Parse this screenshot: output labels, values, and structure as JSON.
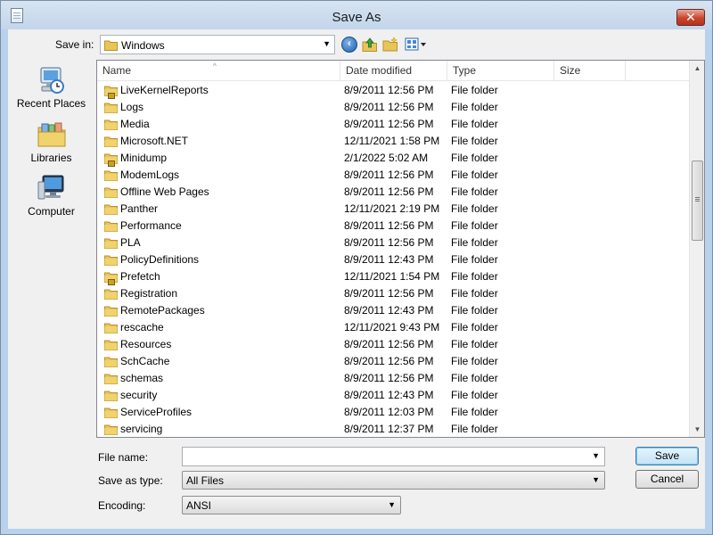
{
  "window": {
    "title": "Save As"
  },
  "toolbar": {
    "save_in_label": "Save in:",
    "save_in_value": "Windows"
  },
  "places": [
    {
      "label": "Recent Places",
      "icon": "recent-places-icon"
    },
    {
      "label": "Libraries",
      "icon": "libraries-icon"
    },
    {
      "label": "Computer",
      "icon": "computer-icon"
    }
  ],
  "columns": {
    "name": "Name",
    "date": "Date modified",
    "type": "Type",
    "size": "Size"
  },
  "files": [
    {
      "name": "LiveKernelReports",
      "date": "8/9/2011 12:56 PM",
      "type": "File folder",
      "locked": true
    },
    {
      "name": "Logs",
      "date": "8/9/2011 12:56 PM",
      "type": "File folder",
      "locked": false
    },
    {
      "name": "Media",
      "date": "8/9/2011 12:56 PM",
      "type": "File folder",
      "locked": false
    },
    {
      "name": "Microsoft.NET",
      "date": "12/11/2021 1:58 PM",
      "type": "File folder",
      "locked": false
    },
    {
      "name": "Minidump",
      "date": "2/1/2022 5:02 AM",
      "type": "File folder",
      "locked": true
    },
    {
      "name": "ModemLogs",
      "date": "8/9/2011 12:56 PM",
      "type": "File folder",
      "locked": false
    },
    {
      "name": "Offline Web Pages",
      "date": "8/9/2011 12:56 PM",
      "type": "File folder",
      "locked": false
    },
    {
      "name": "Panther",
      "date": "12/11/2021 2:19 PM",
      "type": "File folder",
      "locked": false
    },
    {
      "name": "Performance",
      "date": "8/9/2011 12:56 PM",
      "type": "File folder",
      "locked": false
    },
    {
      "name": "PLA",
      "date": "8/9/2011 12:56 PM",
      "type": "File folder",
      "locked": false
    },
    {
      "name": "PolicyDefinitions",
      "date": "8/9/2011 12:43 PM",
      "type": "File folder",
      "locked": false
    },
    {
      "name": "Prefetch",
      "date": "12/11/2021 1:54 PM",
      "type": "File folder",
      "locked": true
    },
    {
      "name": "Registration",
      "date": "8/9/2011 12:56 PM",
      "type": "File folder",
      "locked": false
    },
    {
      "name": "RemotePackages",
      "date": "8/9/2011 12:43 PM",
      "type": "File folder",
      "locked": false
    },
    {
      "name": "rescache",
      "date": "12/11/2021 9:43 PM",
      "type": "File folder",
      "locked": false
    },
    {
      "name": "Resources",
      "date": "8/9/2011 12:56 PM",
      "type": "File folder",
      "locked": false
    },
    {
      "name": "SchCache",
      "date": "8/9/2011 12:56 PM",
      "type": "File folder",
      "locked": false
    },
    {
      "name": "schemas",
      "date": "8/9/2011 12:56 PM",
      "type": "File folder",
      "locked": false
    },
    {
      "name": "security",
      "date": "8/9/2011 12:43 PM",
      "type": "File folder",
      "locked": false
    },
    {
      "name": "ServiceProfiles",
      "date": "8/9/2011 12:03 PM",
      "type": "File folder",
      "locked": false
    },
    {
      "name": "servicing",
      "date": "8/9/2011 12:37 PM",
      "type": "File folder",
      "locked": false
    }
  ],
  "form": {
    "file_name_label": "File name:",
    "file_name_value": "",
    "save_as_type_label": "Save as type:",
    "save_as_type_value": "All Files",
    "encoding_label": "Encoding:",
    "encoding_value": "ANSI"
  },
  "buttons": {
    "save": "Save",
    "cancel": "Cancel"
  },
  "colors": {
    "titlebar": "#c2d5ea",
    "close": "#c9442b",
    "folder": "#e8c55a",
    "accent": "#3c7fb1"
  }
}
